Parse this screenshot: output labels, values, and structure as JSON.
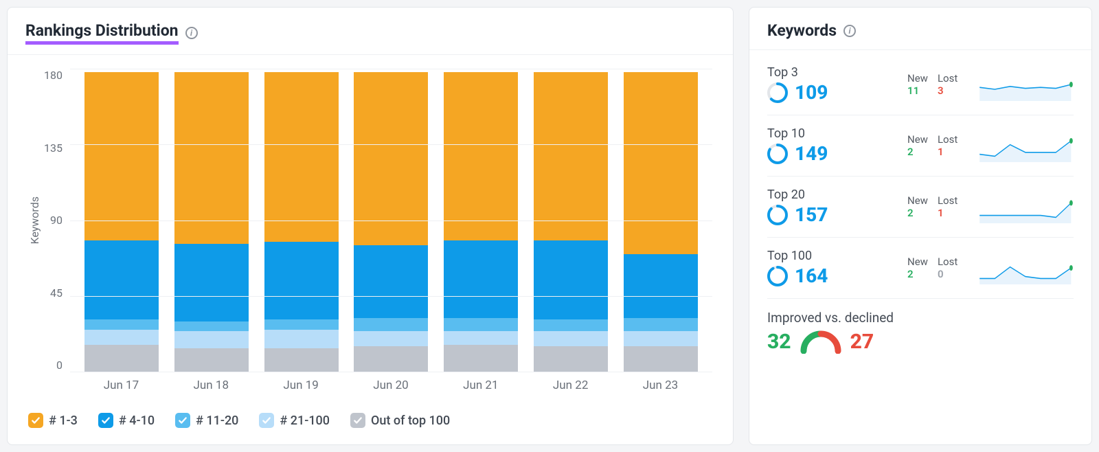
{
  "left_panel": {
    "title": "Rankings Distribution",
    "y_axis_label": "Keywords"
  },
  "chart_data": {
    "type": "bar",
    "stacked": true,
    "ylabel": "Keywords",
    "ylim": [
      0,
      180
    ],
    "y_ticks": [
      "180",
      "135",
      "90",
      "45",
      "0"
    ],
    "categories": [
      "Jun 17",
      "Jun 18",
      "Jun 19",
      "Jun 20",
      "Jun 21",
      "Jun 22",
      "Jun 23"
    ],
    "series": [
      {
        "name": "# 1-3",
        "color": "#F5A623",
        "values": [
          100,
          102,
          101,
          103,
          100,
          100,
          108
        ]
      },
      {
        "name": "# 4-10",
        "color": "#0E9BE8",
        "values": [
          47,
          46,
          46,
          43,
          46,
          47,
          38
        ]
      },
      {
        "name": "# 11-20",
        "color": "#59BDF0",
        "values": [
          6,
          6,
          6,
          8,
          8,
          7,
          8
        ]
      },
      {
        "name": "# 21-100",
        "color": "#B7DDF9",
        "values": [
          9,
          10,
          11,
          9,
          8,
          9,
          9
        ]
      },
      {
        "name": "Out of top 100",
        "color": "#BFC4CC",
        "values": [
          16,
          14,
          14,
          15,
          16,
          15,
          15
        ]
      }
    ],
    "legend": [
      "# 1-3",
      "# 4-10",
      "# 11-20",
      "# 21-100",
      "Out of top 100"
    ]
  },
  "right_panel": {
    "title": "Keywords",
    "rows": [
      {
        "label": "Top 3",
        "value": "109",
        "new_label": "New",
        "new": "11",
        "lost_label": "Lost",
        "lost": "3",
        "lost_zero": false,
        "ring_pct": 0.62,
        "spark": [
          18,
          20,
          17,
          19,
          18,
          19,
          15
        ]
      },
      {
        "label": "Top 10",
        "value": "149",
        "new_label": "New",
        "new": "2",
        "lost_label": "Lost",
        "lost": "1",
        "lost_zero": false,
        "ring_pct": 0.83,
        "spark": [
          24,
          26,
          14,
          22,
          22,
          22,
          10
        ]
      },
      {
        "label": "Top 20",
        "value": "157",
        "new_label": "New",
        "new": "2",
        "lost_label": "Lost",
        "lost": "1",
        "lost_zero": false,
        "ring_pct": 0.87,
        "spark": [
          24,
          24,
          24,
          24,
          24,
          26,
          11
        ]
      },
      {
        "label": "Top 100",
        "value": "164",
        "new_label": "New",
        "new": "2",
        "lost_label": "Lost",
        "lost": "0",
        "lost_zero": true,
        "ring_pct": 0.91,
        "spark": [
          26,
          26,
          14,
          24,
          26,
          26,
          15
        ]
      }
    ],
    "improved_declined": {
      "label": "Improved vs. declined",
      "improved": "32",
      "declined": "27"
    }
  }
}
